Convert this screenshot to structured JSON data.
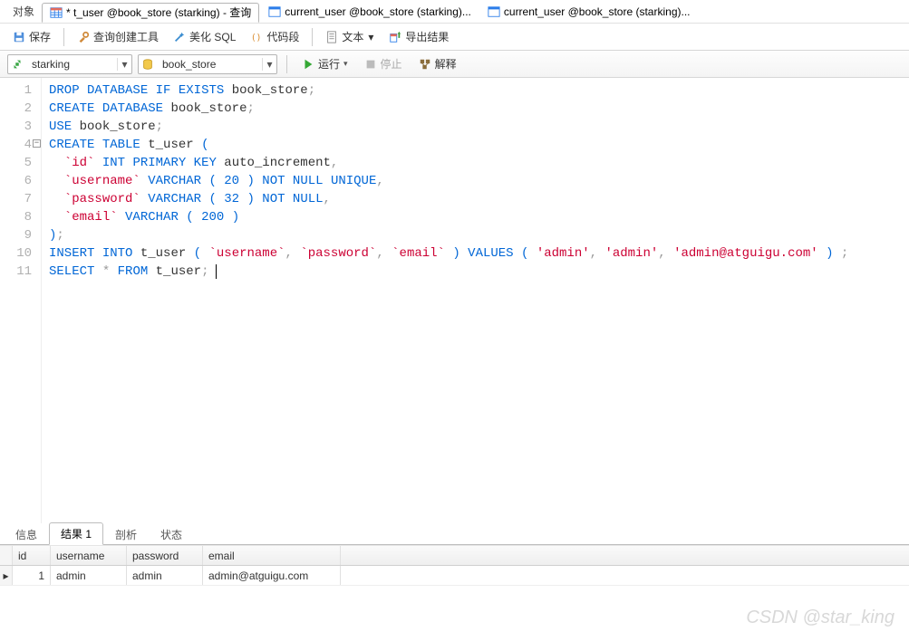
{
  "tabs": {
    "object_label": "对象",
    "items": [
      {
        "label": "* t_user @book_store (starking) - 查询",
        "active": true
      },
      {
        "label": "current_user @book_store (starking)...",
        "active": false
      },
      {
        "label": "current_user @book_store (starking)...",
        "active": false
      }
    ]
  },
  "toolbar": {
    "save": "保存",
    "query_builder": "查询创建工具",
    "beautify": "美化 SQL",
    "snippet": "代码段",
    "text": "文本",
    "export": "导出结果"
  },
  "selectors": {
    "connection": "starking",
    "database": "book_store",
    "run": "运行",
    "stop": "停止",
    "explain": "解释"
  },
  "code": {
    "lines": [
      {
        "n": 1,
        "tokens": [
          [
            "kw",
            "DROP"
          ],
          [
            "sp",
            " "
          ],
          [
            "kw",
            "DATABASE"
          ],
          [
            "sp",
            " "
          ],
          [
            "kw",
            "IF"
          ],
          [
            "sp",
            " "
          ],
          [
            "kw",
            "EXISTS"
          ],
          [
            "sp",
            " "
          ],
          [
            "id",
            "book_store"
          ],
          [
            "pn",
            ";"
          ]
        ]
      },
      {
        "n": 2,
        "tokens": [
          [
            "kw",
            "CREATE"
          ],
          [
            "sp",
            " "
          ],
          [
            "kw",
            "DATABASE"
          ],
          [
            "sp",
            " "
          ],
          [
            "id",
            "book_store"
          ],
          [
            "pn",
            ";"
          ]
        ]
      },
      {
        "n": 3,
        "tokens": [
          [
            "kw",
            "USE"
          ],
          [
            "sp",
            " "
          ],
          [
            "id",
            "book_store"
          ],
          [
            "pn",
            ";"
          ]
        ]
      },
      {
        "n": 4,
        "fold": true,
        "tokens": [
          [
            "kw",
            "CREATE"
          ],
          [
            "sp",
            " "
          ],
          [
            "kw",
            "TABLE"
          ],
          [
            "sp",
            " "
          ],
          [
            "id",
            "t_user"
          ],
          [
            "sp",
            " "
          ],
          [
            "par",
            "("
          ]
        ]
      },
      {
        "n": 5,
        "tokens": [
          [
            "sp",
            "  "
          ],
          [
            "bt",
            "`id`"
          ],
          [
            "sp",
            " "
          ],
          [
            "kw",
            "INT"
          ],
          [
            "sp",
            " "
          ],
          [
            "kw",
            "PRIMARY"
          ],
          [
            "sp",
            " "
          ],
          [
            "kw",
            "KEY"
          ],
          [
            "sp",
            " "
          ],
          [
            "id",
            "auto_increment"
          ],
          [
            "pn",
            ","
          ]
        ]
      },
      {
        "n": 6,
        "tokens": [
          [
            "sp",
            "  "
          ],
          [
            "bt",
            "`username`"
          ],
          [
            "sp",
            " "
          ],
          [
            "kw",
            "VARCHAR"
          ],
          [
            "sp",
            " "
          ],
          [
            "par",
            "("
          ],
          [
            "sp",
            " "
          ],
          [
            "num",
            "20"
          ],
          [
            "sp",
            " "
          ],
          [
            "par",
            ")"
          ],
          [
            "sp",
            " "
          ],
          [
            "kw",
            "NOT"
          ],
          [
            "sp",
            " "
          ],
          [
            "kw",
            "NULL"
          ],
          [
            "sp",
            " "
          ],
          [
            "kw",
            "UNIQUE"
          ],
          [
            "pn",
            ","
          ]
        ]
      },
      {
        "n": 7,
        "tokens": [
          [
            "sp",
            "  "
          ],
          [
            "bt",
            "`password`"
          ],
          [
            "sp",
            " "
          ],
          [
            "kw",
            "VARCHAR"
          ],
          [
            "sp",
            " "
          ],
          [
            "par",
            "("
          ],
          [
            "sp",
            " "
          ],
          [
            "num",
            "32"
          ],
          [
            "sp",
            " "
          ],
          [
            "par",
            ")"
          ],
          [
            "sp",
            " "
          ],
          [
            "kw",
            "NOT"
          ],
          [
            "sp",
            " "
          ],
          [
            "kw",
            "NULL"
          ],
          [
            "pn",
            ","
          ]
        ]
      },
      {
        "n": 8,
        "tokens": [
          [
            "sp",
            "  "
          ],
          [
            "bt",
            "`email`"
          ],
          [
            "sp",
            " "
          ],
          [
            "kw",
            "VARCHAR"
          ],
          [
            "sp",
            " "
          ],
          [
            "par",
            "("
          ],
          [
            "sp",
            " "
          ],
          [
            "num",
            "200"
          ],
          [
            "sp",
            " "
          ],
          [
            "par",
            ")"
          ]
        ]
      },
      {
        "n": 9,
        "tokens": [
          [
            "par",
            ")"
          ],
          [
            "pn",
            ";"
          ]
        ]
      },
      {
        "n": 10,
        "tokens": [
          [
            "kw",
            "INSERT"
          ],
          [
            "sp",
            " "
          ],
          [
            "kw",
            "INTO"
          ],
          [
            "sp",
            " "
          ],
          [
            "id",
            "t_user"
          ],
          [
            "sp",
            " "
          ],
          [
            "par",
            "("
          ],
          [
            "sp",
            " "
          ],
          [
            "bt",
            "`username`"
          ],
          [
            "pn",
            ","
          ],
          [
            "sp",
            " "
          ],
          [
            "bt",
            "`password`"
          ],
          [
            "pn",
            ","
          ],
          [
            "sp",
            " "
          ],
          [
            "bt",
            "`email`"
          ],
          [
            "sp",
            " "
          ],
          [
            "par",
            ")"
          ],
          [
            "sp",
            " "
          ],
          [
            "kw",
            "VALUES"
          ],
          [
            "sp",
            " "
          ],
          [
            "par",
            "("
          ],
          [
            "sp",
            " "
          ],
          [
            "str",
            "'admin'"
          ],
          [
            "pn",
            ","
          ],
          [
            "sp",
            " "
          ],
          [
            "str",
            "'admin'"
          ],
          [
            "pn",
            ","
          ],
          [
            "sp",
            " "
          ],
          [
            "str",
            "'admin@atguigu.com'"
          ],
          [
            "sp",
            " "
          ],
          [
            "par",
            ")"
          ],
          [
            "sp",
            " "
          ],
          [
            "pn",
            ";"
          ]
        ]
      },
      {
        "n": 11,
        "caret": true,
        "tokens": [
          [
            "kw",
            "SELECT"
          ],
          [
            "sp",
            " "
          ],
          [
            "pn",
            "*"
          ],
          [
            "sp",
            " "
          ],
          [
            "kw",
            "FROM"
          ],
          [
            "sp",
            " "
          ],
          [
            "id",
            "t_user"
          ],
          [
            "pn",
            ";"
          ]
        ]
      }
    ]
  },
  "result_tabs": {
    "info": "信息",
    "result": "结果 1",
    "profile": "剖析",
    "status": "状态"
  },
  "grid": {
    "columns": {
      "id": "id",
      "username": "username",
      "password": "password",
      "email": "email"
    },
    "rows": [
      {
        "id": "1",
        "username": "admin",
        "password": "admin",
        "email": "admin@atguigu.com"
      }
    ]
  },
  "watermark": "CSDN @star_king"
}
